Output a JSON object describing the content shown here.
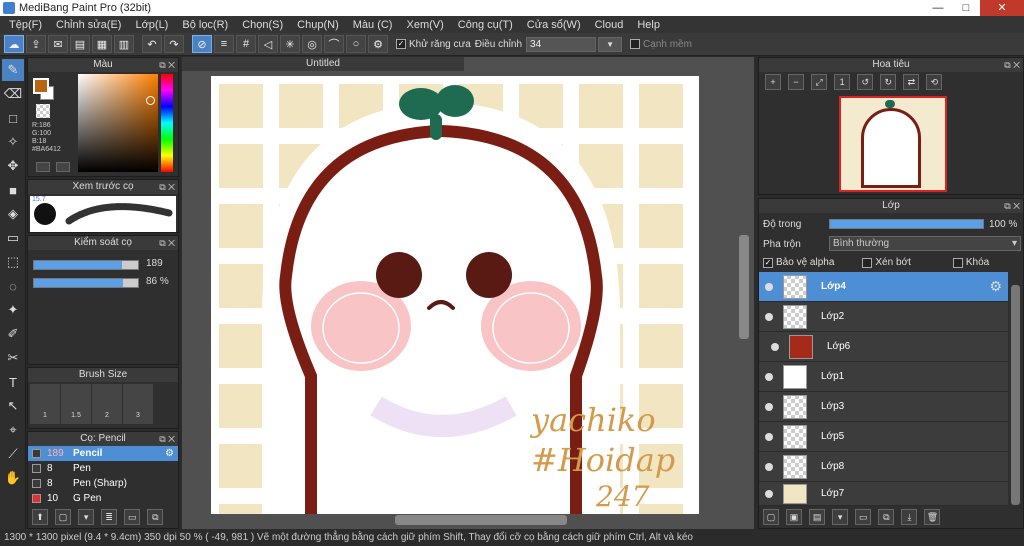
{
  "window": {
    "title": "MediBang Paint Pro (32bit)",
    "minimize": "—",
    "maximize": "□",
    "close": "✕"
  },
  "menu": [
    "Tệp(F)",
    "Chỉnh sửa(E)",
    "Lớp(L)",
    "Bộ lọc(R)",
    "Chọn(S)",
    "Chụp(N)",
    "Màu (C)",
    "Xem(V)",
    "Công cụ(T)",
    "Cửa sổ(W)",
    "Cloud",
    "Help"
  ],
  "toolbar": {
    "antialias_label": "Khử răng cưa",
    "adjust_label": "Điều chỉnh",
    "adjust_value": "34",
    "edge_label": "Cạnh mềm"
  },
  "panels": {
    "color": {
      "title": "Màu",
      "r": "R:186",
      "g": "G:100",
      "b": "B:18",
      "hex": "#BA6412",
      "fg": "#ba6412",
      "bg": "#ffffff"
    },
    "brush_preview": {
      "title": "Xem trước cọ",
      "size": "15.7"
    },
    "brush_control": {
      "title": "Kiểm soát cọ",
      "size_value": "189",
      "opacity_value": "86 %",
      "size_fraction": 0.85,
      "opacity_fraction": 0.86
    },
    "brush_size": {
      "title": "Brush Size",
      "sizes": [
        "1",
        "1.5",
        "2",
        "3"
      ]
    },
    "brush_list": {
      "title": "Cọ: Pencil",
      "items": [
        {
          "size": "189",
          "name": "Pencil",
          "selected": true,
          "color": "#3a3a3a"
        },
        {
          "size": "8",
          "name": "Pen",
          "selected": false,
          "color": "#3a3a3a"
        },
        {
          "size": "8",
          "name": "Pen (Sharp)",
          "selected": false,
          "color": "#3a3a3a"
        },
        {
          "size": "10",
          "name": "G Pen",
          "selected": false,
          "color": "#e03030"
        }
      ]
    },
    "navigator": {
      "title": "Hoa tiêu"
    },
    "layers": {
      "title": "Lớp",
      "opacity_label": "Độ trong",
      "opacity_value": "100 %",
      "blend_label": "Pha trộn",
      "blend_value": "Bình thường",
      "protect_alpha": "Bảo vệ alpha",
      "clipping": "Xén bớt",
      "lock": "Khóa",
      "items": [
        {
          "name": "Lớp4",
          "selected": true
        },
        {
          "name": "Lớp2",
          "selected": false
        },
        {
          "name": "Lớp6",
          "selected": false
        },
        {
          "name": "Lớp1",
          "selected": false
        },
        {
          "name": "Lớp3",
          "selected": false
        },
        {
          "name": "Lớp5",
          "selected": false
        },
        {
          "name": "Lớp8",
          "selected": false
        },
        {
          "name": "Lớp7",
          "selected": false
        }
      ]
    }
  },
  "canvas": {
    "tab": "Untitled",
    "signature_line1": "yachiko",
    "signature_line2": "#Hoidap",
    "signature_line3": "247"
  },
  "status": {
    "text": "1300 * 1300 pixel   (9.4 * 9.4cm)   350 dpi   50 %   ( -49, 981 )   Vẽ một đường thẳng bằng cách giữ phím Shift, Thay đổi cỡ cọ bằng cách giữ phím Ctrl, Alt và kéo"
  }
}
